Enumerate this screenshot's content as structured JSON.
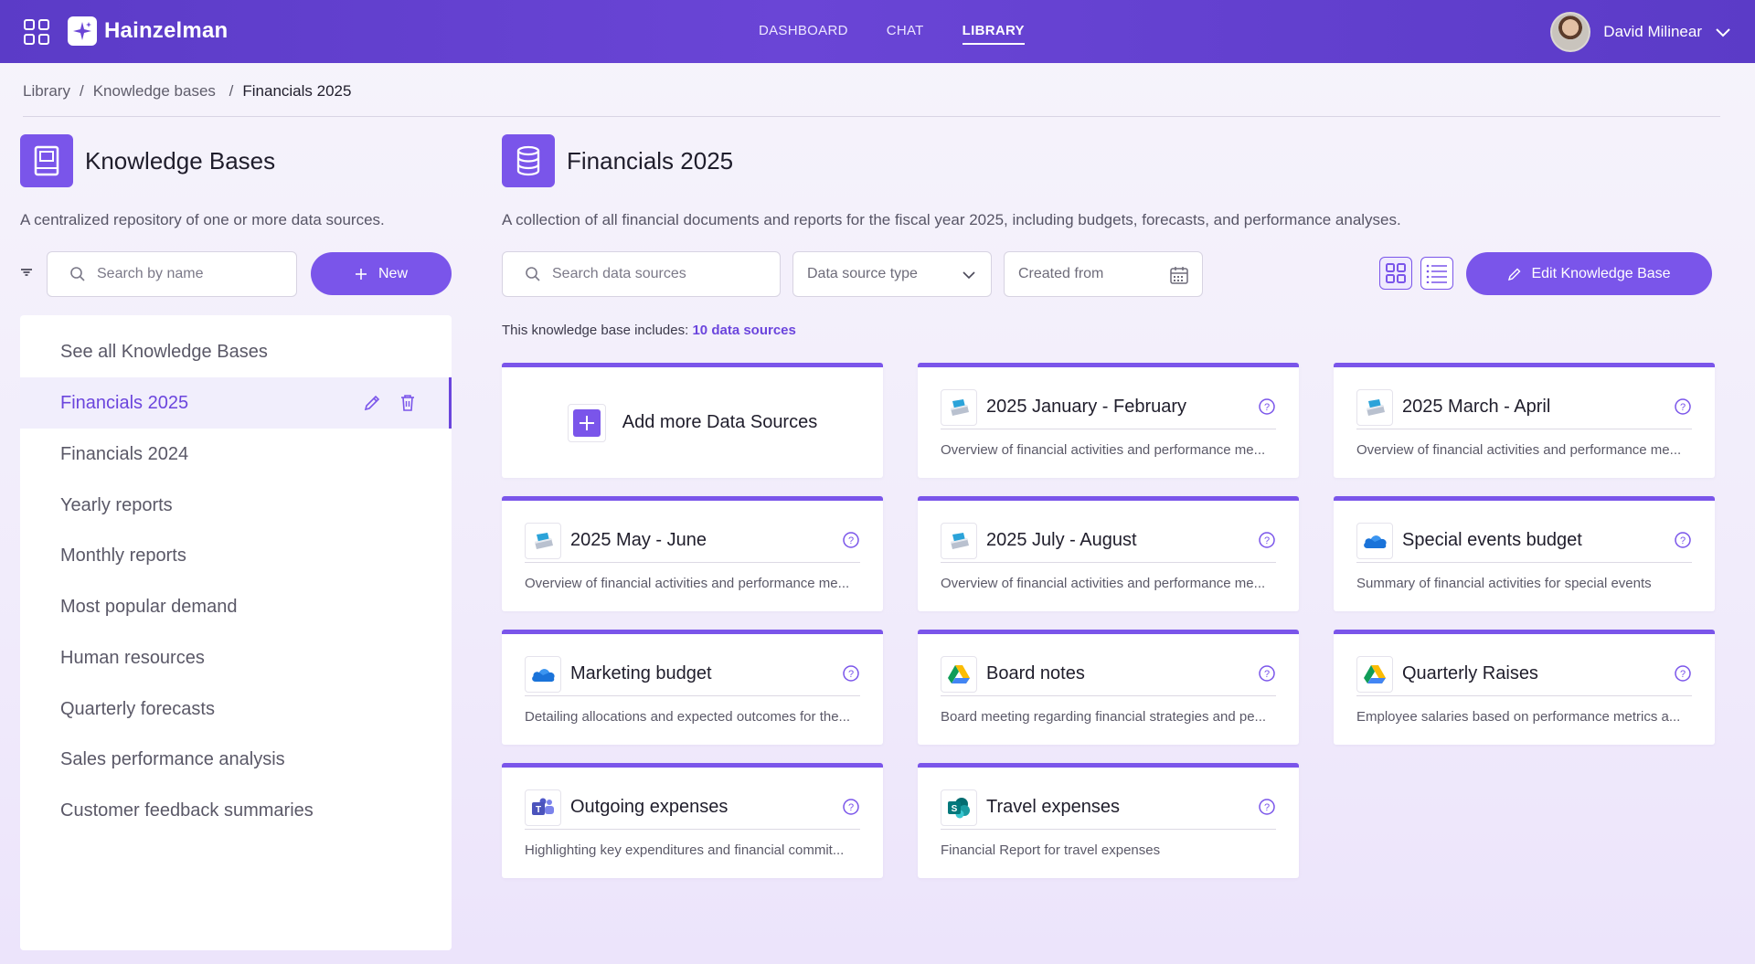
{
  "app": {
    "name": "Hainzelman"
  },
  "nav": {
    "dashboard": "DASHBOARD",
    "chat": "CHAT",
    "library": "LIBRARY"
  },
  "user": {
    "name": "David Milinear"
  },
  "breadcrumb": {
    "library": "Library",
    "knowledge_bases": "Knowledge bases",
    "current": "Financials 2025"
  },
  "left": {
    "title": "Knowledge Bases",
    "description": "A centralized repository of one or more data sources.",
    "search_placeholder": "Search by name",
    "new_label": "New",
    "items": [
      "See all Knowledge Bases",
      "Financials 2025",
      "Financials 2024",
      "Yearly reports",
      "Monthly reports",
      "Most popular demand",
      "Human resources",
      "Quarterly forecasts",
      "Sales performance analysis",
      "Customer feedback summaries"
    ]
  },
  "main": {
    "title": "Financials 2025",
    "description": "A collection of all financial documents and reports for the fiscal year 2025, including budgets, forecasts, and performance analyses.",
    "search_placeholder": "Search data sources",
    "type_select": "Data source type",
    "created_from": "Created from",
    "edit_label": "Edit Knowledge Base",
    "includes_prefix": "This knowledge base includes:",
    "includes_count": "10 data sources",
    "add_label": "Add more Data Sources",
    "cards": [
      {
        "title": "2025 January - February",
        "desc": "Overview of financial activities and performance me...",
        "icon": "drive-server-icon"
      },
      {
        "title": "2025 March - April",
        "desc": "Overview of financial activities and performance me...",
        "icon": "drive-server-icon"
      },
      {
        "title": "2025 May - June",
        "desc": "Overview of financial activities and performance me...",
        "icon": "drive-server-icon"
      },
      {
        "title": "2025 July - August",
        "desc": "Overview of financial activities and performance me...",
        "icon": "drive-server-icon"
      },
      {
        "title": "Special events budget",
        "desc": "Summary of financial activities for special events",
        "icon": "onedrive-icon"
      },
      {
        "title": "Marketing budget",
        "desc": "Detailing allocations and expected outcomes for the...",
        "icon": "onedrive-icon"
      },
      {
        "title": "Board notes",
        "desc": "Board meeting regarding financial strategies and pe...",
        "icon": "google-drive-icon"
      },
      {
        "title": "Quarterly Raises",
        "desc": "Employee salaries based on performance metrics a...",
        "icon": "google-drive-icon"
      },
      {
        "title": "Outgoing expenses",
        "desc": "Highlighting key expenditures and financial commit...",
        "icon": "teams-icon"
      },
      {
        "title": "Travel expenses",
        "desc": "Financial Report for travel expenses",
        "icon": "sharepoint-icon"
      }
    ]
  },
  "colors": {
    "accent": "#7a55ea",
    "header": "#5b3bc7"
  }
}
